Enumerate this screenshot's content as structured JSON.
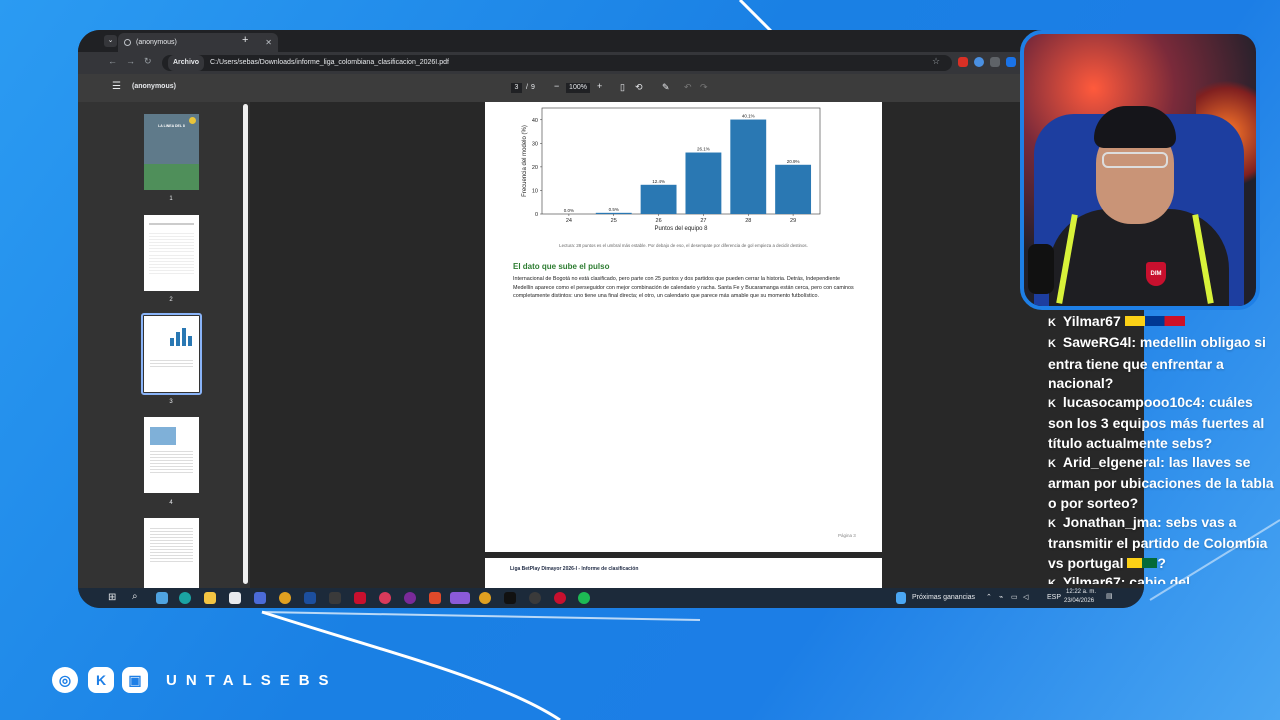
{
  "browser": {
    "tab_title": "(anonymous)",
    "new_tab": "+",
    "address_chip": "Archivo",
    "url": "C:/Users/sebas/Downloads/informe_liga_colombiana_clasificacion_2026I.pdf"
  },
  "pdf_toolbar": {
    "document_title": "(anonymous)",
    "current_page": "3",
    "page_separator": "/",
    "total_pages": "9",
    "zoom": "100%",
    "zoom_out": "−",
    "zoom_in": "+"
  },
  "thumbnails": [
    {
      "number": "1",
      "title": "LA LINEA DEL 8"
    },
    {
      "number": "2"
    },
    {
      "number": "3"
    },
    {
      "number": "4"
    },
    {
      "number": ""
    }
  ],
  "page": {
    "chart_data": {
      "type": "bar",
      "categories": [
        "24",
        "25",
        "26",
        "27",
        "28",
        "29"
      ],
      "values": [
        0.0,
        0.5,
        12.4,
        26.1,
        40.1,
        20.9
      ],
      "value_labels": [
        "0.0%",
        "0.5%",
        "12.4%",
        "26.1%",
        "40.1%",
        "20.9%"
      ],
      "xlabel": "Puntos del equipo 8",
      "ylabel": "Frecuencia del modelo (%)",
      "yticks": [
        "0",
        "10",
        "20",
        "30",
        "40"
      ],
      "ylim": [
        0,
        45
      ],
      "bar_color": "#2a78b3"
    },
    "caption": "Lectura: 28 puntos es el umbral más estable. Por debajo de eso, el desempate por diferencia de gol empieza a decidir destinos.",
    "heading": "El dato que sube el pulso",
    "paragraph": "Internacional de Bogotá no está clasificado, pero parte con 25 puntos y dos partidos que pueden cerrar la historia. Detrás, Independiente Medellín aparece como el perseguidor con mejor combinación de calendario y racha. Santa Fe y Bucaramanga están cerca, pero con caminos completamente distintos: uno tiene una final directa; el otro, un calendario que parece más amable que su momento futbolístico.",
    "page_number": "Página 3",
    "next_page_header": "Liga BetPlay Dimayor 2026-I - Informe de clasificación"
  },
  "taskbar": {
    "weather": "Próximas ganancias",
    "lang": "ESP",
    "time": "12:22 a. m.",
    "date": "23/04/2026"
  },
  "chat": [
    {
      "user": "Yilmar67",
      "text": ""
    },
    {
      "user": "SaweRG4l",
      "text": ": medellin obligao si entra tiene que enfrentar a nacional?"
    },
    {
      "user": "lucasocampooo10c4",
      "text": ": cuáles son los 3 equipos más fuertes al título actualmente sebs?"
    },
    {
      "user": "Arid_elgeneral",
      "text": ": las llaves se arman por ubicaciones de la tabla o por sorteo?"
    },
    {
      "user": "Jonathan_jma",
      "text": ": sebs vas a transmitir el partido de Colombia vs portugal"
    },
    {
      "user": "Yilmar67",
      "text": ": cabio del"
    }
  ],
  "social": {
    "handle": "UNTALSEBS"
  },
  "colors": {
    "brand_blue": "#1e7fe6",
    "heading_green": "#2e7d32",
    "bar_blue": "#2a78b3"
  }
}
